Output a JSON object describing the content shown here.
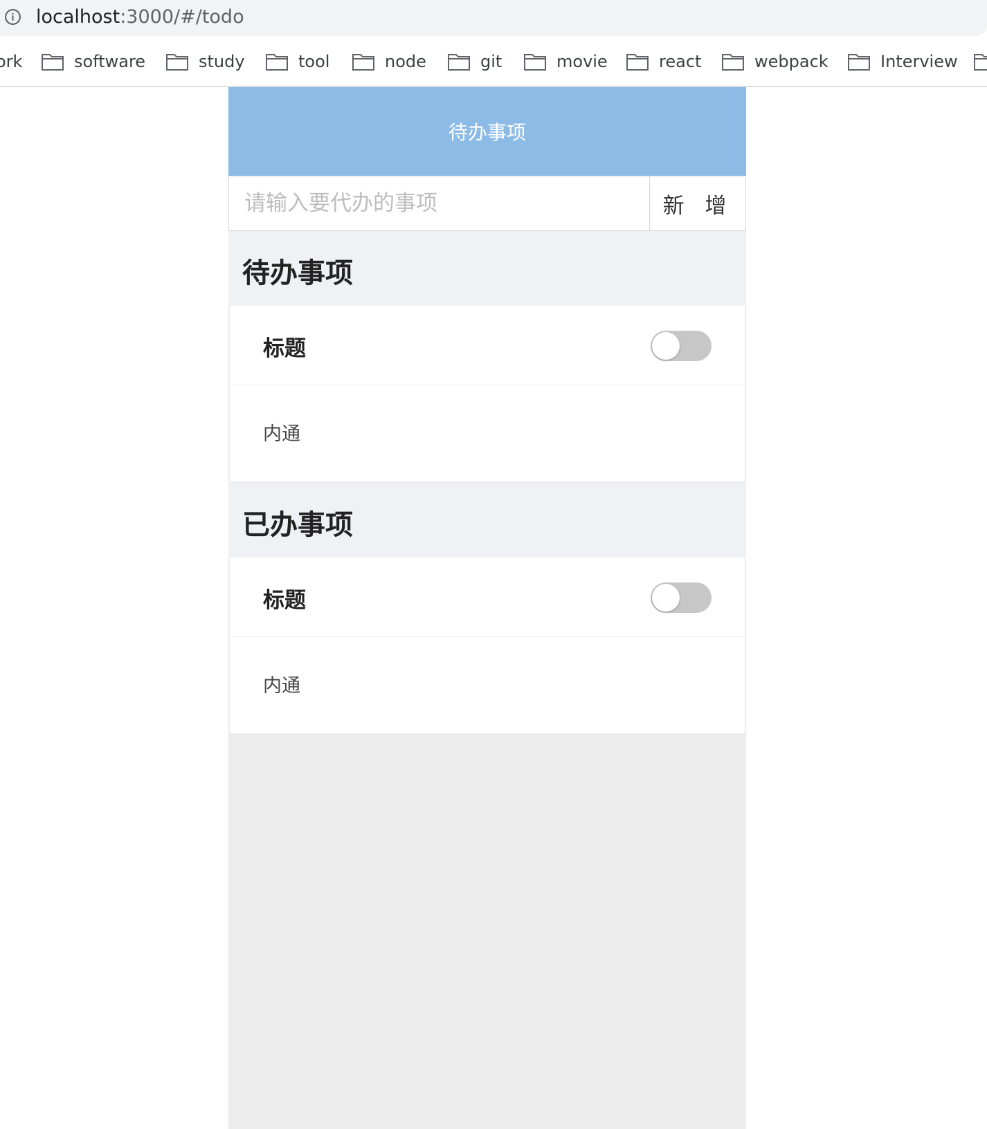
{
  "browser": {
    "url_host": "localhost",
    "url_path": ":3000/#/todo",
    "info_icon": "info-icon",
    "bookmarks": [
      {
        "label": "ork"
      },
      {
        "label": "software"
      },
      {
        "label": "study"
      },
      {
        "label": "tool"
      },
      {
        "label": "node"
      },
      {
        "label": "git"
      },
      {
        "label": "movie"
      },
      {
        "label": "react"
      },
      {
        "label": "webpack"
      },
      {
        "label": "Interview"
      }
    ]
  },
  "app": {
    "navbar_title": "待办事项",
    "add": {
      "placeholder": "请输入要代办的事项",
      "value": "",
      "button_label": "新 增"
    },
    "pending": {
      "header": "待办事项",
      "items": [
        {
          "title": "标题",
          "content": "内通",
          "done": false
        }
      ]
    },
    "done": {
      "header": "已办事项",
      "items": [
        {
          "title": "标题",
          "content": "内通",
          "done": false
        }
      ]
    },
    "colors": {
      "navbar": "#8cbbe6",
      "section_bg": "#f0f1f5",
      "app_bg": "#ececed",
      "switch_off": "#c7c7c7"
    }
  }
}
